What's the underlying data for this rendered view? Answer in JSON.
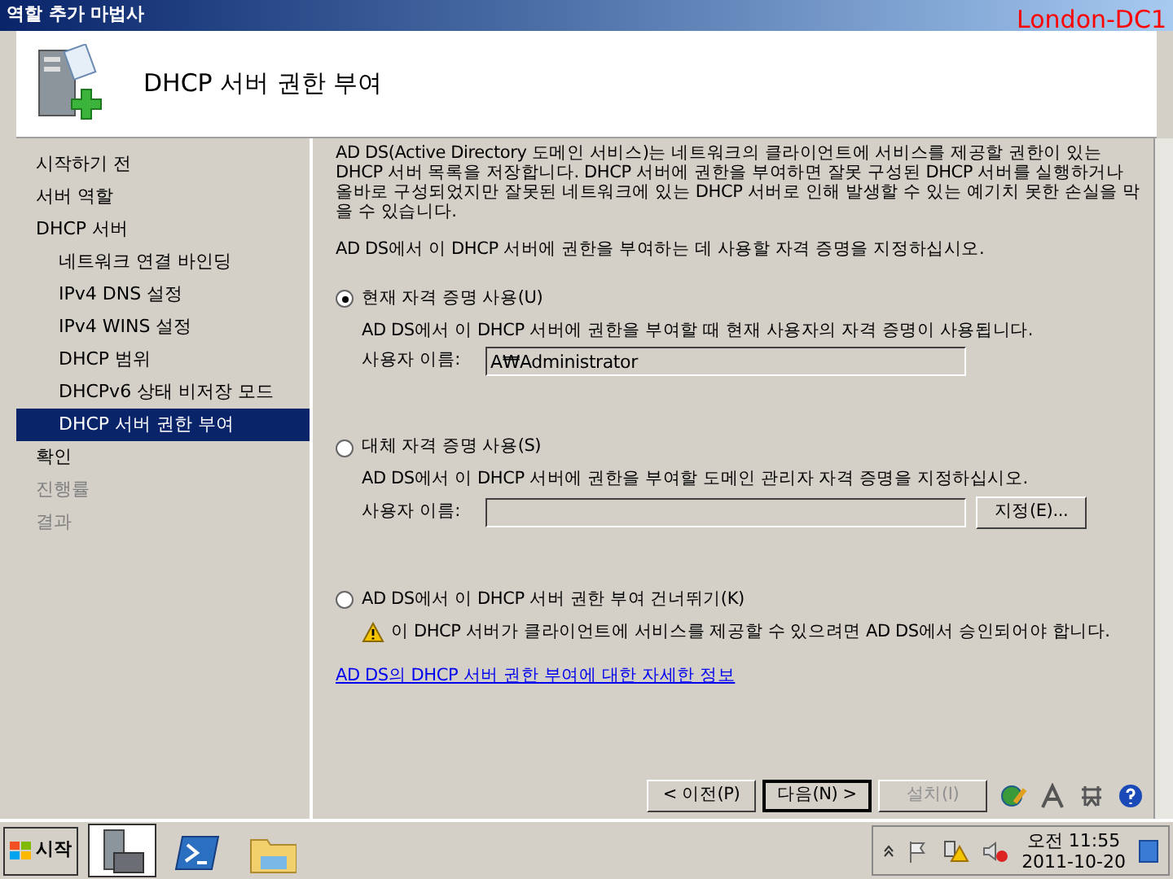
{
  "window": {
    "title": "역할 추가 마법사",
    "overlay_label": "London-DC1"
  },
  "header": {
    "title": "DHCP 서버 권한 부여"
  },
  "sidebar": {
    "items": [
      {
        "label": "시작하기 전",
        "selected": false,
        "disabled": false
      },
      {
        "label": "서버 역할",
        "selected": false,
        "disabled": false
      },
      {
        "label": "DHCP 서버",
        "selected": false,
        "disabled": false,
        "children": [
          {
            "label": "네트워크 연결 바인딩",
            "selected": false,
            "disabled": false
          },
          {
            "label": "IPv4 DNS 설정",
            "selected": false,
            "disabled": false
          },
          {
            "label": "IPv4 WINS 설정",
            "selected": false,
            "disabled": false
          },
          {
            "label": "DHCP 범위",
            "selected": false,
            "disabled": false
          },
          {
            "label": "DHCPv6 상태 비저장 모드",
            "selected": false,
            "disabled": false
          },
          {
            "label": "DHCP 서버 권한 부여",
            "selected": true,
            "disabled": false
          }
        ]
      },
      {
        "label": "확인",
        "selected": false,
        "disabled": false
      },
      {
        "label": "진행률",
        "selected": false,
        "disabled": true
      },
      {
        "label": "결과",
        "selected": false,
        "disabled": true
      }
    ]
  },
  "content": {
    "intro": "AD DS(Active Directory 도메인 서비스)는 네트워크의 클라이언트에 서비스를 제공할 권한이 있는 DHCP 서버 목록을 저장합니다. DHCP 서버에 권한을 부여하면 잘못 구성된 DHCP 서버를 실행하거나 올바로 구성되었지만 잘못된 네트워크에 있는 DHCP 서버로 인해 발생할 수 있는 예기치 못한 손실을 막을 수 있습니다.",
    "instruction": "AD DS에서 이 DHCP 서버에 권한을 부여하는 데 사용할 자격 증명을 지정하십시오.",
    "options": [
      {
        "kind": "credential",
        "label": "현재 자격 증명 사용(U)",
        "selected": true,
        "description": "AD DS에서 이 DHCP 서버에 권한을 부여할 때 현재 사용자의 자격 증명이 사용됩니다.",
        "field_label": "사용자 이름:",
        "value": "A₩Administrator"
      },
      {
        "kind": "credential",
        "label": "대체 자격 증명 사용(S)",
        "selected": false,
        "description": "AD DS에서 이 DHCP 서버에 권한을 부여할 도메인 관리자 자격 증명을 지정하십시오.",
        "field_label": "사용자 이름:",
        "button": "지정(E)..."
      },
      {
        "kind": "warning",
        "label": "AD DS에서 이 DHCP 서버 권한 부여 건너뛰기(K)",
        "selected": false,
        "description": "이 DHCP 서버가 클라이언트에 서비스를 제공할 수 있으려면 AD DS에서 승인되어야 합니다."
      }
    ],
    "link": "AD DS의 DHCP 서버 권한 부여에 대한 자세한 정보"
  },
  "buttons": [
    {
      "label": "< 이전(P)",
      "disabled": false,
      "default": false
    },
    {
      "label": "다음(N) >",
      "disabled": false,
      "default": true
    },
    {
      "label": "설치(I)",
      "disabled": true,
      "default": false
    }
  ],
  "taskbar": {
    "start": "시작",
    "apps": [
      {
        "selected": true
      },
      {
        "selected": false
      },
      {
        "selected": false
      }
    ],
    "clock_time": "오전 11:55",
    "clock_date": "2011-10-20"
  }
}
